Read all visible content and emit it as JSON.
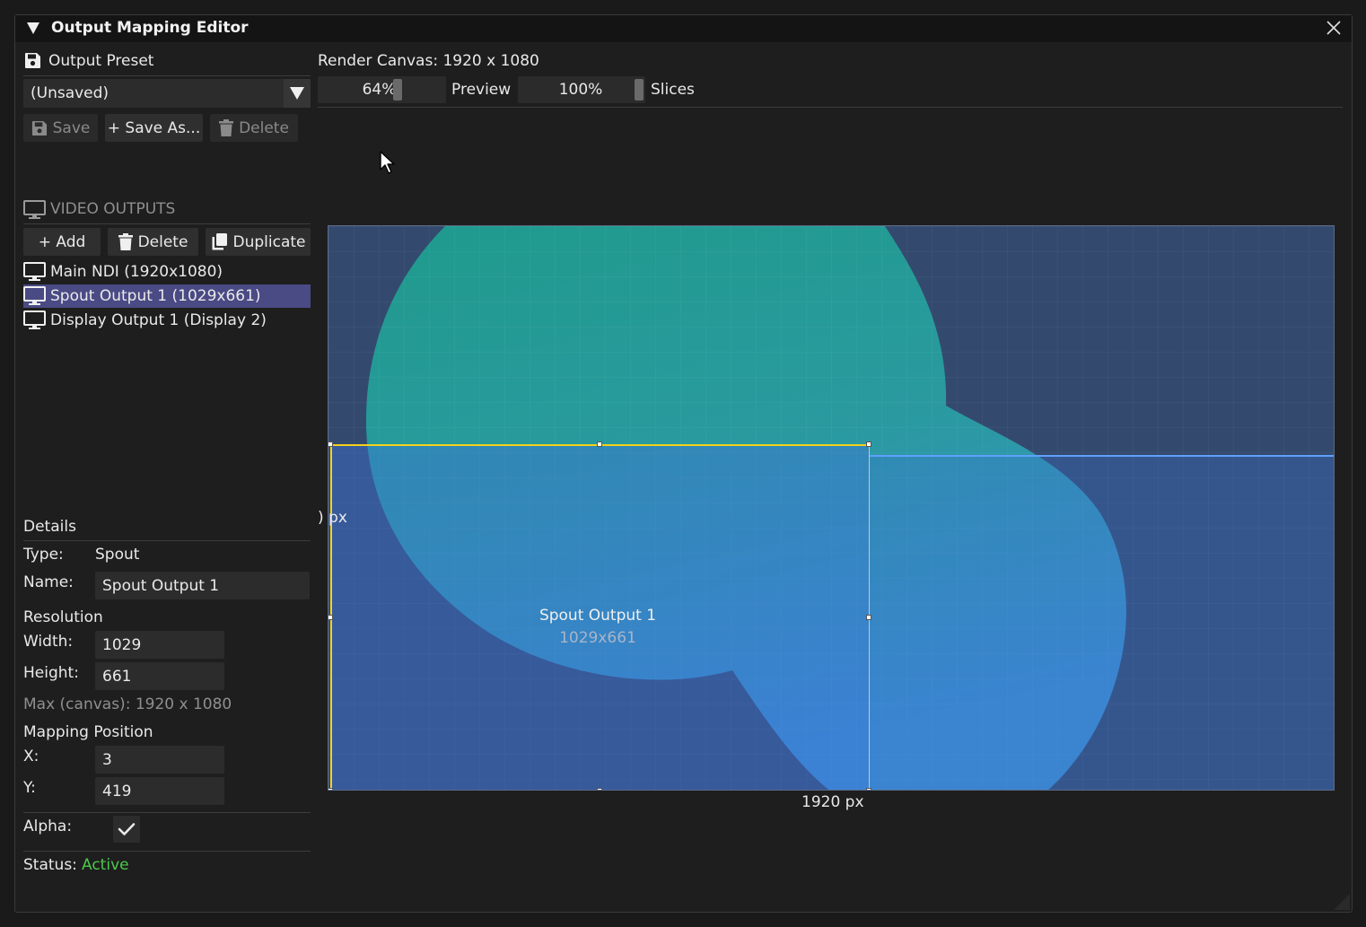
{
  "window": {
    "title": "Output Mapping Editor"
  },
  "preset": {
    "header": "Output Preset",
    "selected": "(Unsaved)",
    "save_label": "Save",
    "save_as_label": "+ Save As...",
    "delete_label": "Delete"
  },
  "render": {
    "canvas_label": "Render Canvas: 1920 x 1080",
    "preview_value": "64%",
    "preview_level": 0.64,
    "preview_label": "Preview",
    "slices_value": "100%",
    "slices_level": 1.0,
    "slices_label": "Slices"
  },
  "outputs": {
    "header": "VIDEO OUTPUTS",
    "add_label": "+ Add",
    "delete_label": "Delete",
    "duplicate_label": "Duplicate",
    "items": [
      {
        "label": "Main NDI (1920x1080)",
        "selected": false
      },
      {
        "label": "Spout Output 1 (1029x661)",
        "selected": true
      },
      {
        "label": "Display Output 1 (Display 2)",
        "selected": false
      }
    ]
  },
  "details": {
    "header": "Details",
    "type_label": "Type:",
    "type_value": "Spout",
    "name_label": "Name:",
    "name_value": "Spout Output 1",
    "resolution_header": "Resolution",
    "width_label": "Width:",
    "width_value": "1029",
    "height_label": "Height:",
    "height_value": "661",
    "max_canvas": "Max (canvas): 1920 x 1080",
    "mapping_header": "Mapping Position",
    "x_label": "X:",
    "x_value": "3",
    "y_label": "Y:",
    "y_value": "419",
    "alpha_label": "Alpha:",
    "alpha_checked": true,
    "status_label": "Status:",
    "status_value": "Active"
  },
  "canvas_view": {
    "selected_name": "Spout Output 1",
    "selected_resolution": "1029x661",
    "width_marker": "1920 px",
    "height_marker": ") px"
  },
  "colors": {
    "selection_yellow": "#f2d21b",
    "list_selected": "#4a4a85",
    "status_active": "#4cc94c"
  }
}
